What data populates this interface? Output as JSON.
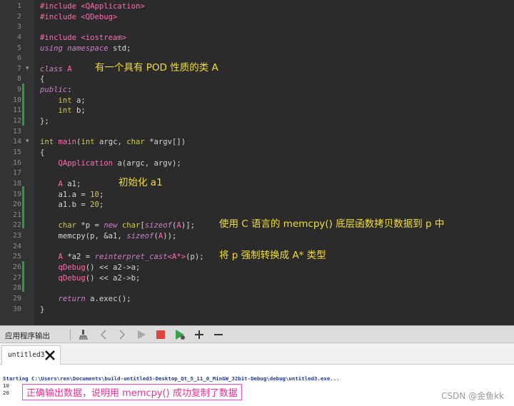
{
  "editor": {
    "lines": [
      {
        "n": "1",
        "tokens": [
          {
            "t": "#include ",
            "c": "pp"
          },
          {
            "t": "<QApplication>",
            "c": "pp"
          }
        ]
      },
      {
        "n": "2",
        "tokens": [
          {
            "t": "#include ",
            "c": "pp"
          },
          {
            "t": "<QDebug>",
            "c": "pp"
          }
        ]
      },
      {
        "n": "3",
        "tokens": []
      },
      {
        "n": "4",
        "tokens": [
          {
            "t": "#include ",
            "c": "pp"
          },
          {
            "t": "<iostream>",
            "c": "pp"
          }
        ]
      },
      {
        "n": "5",
        "tokens": [
          {
            "t": "using namespace",
            "c": "it"
          },
          {
            "t": " std;",
            "c": ""
          }
        ]
      },
      {
        "n": "6",
        "tokens": []
      },
      {
        "n": "7",
        "tokens": [
          {
            "t": "class",
            "c": "it"
          },
          {
            "t": " A",
            "c": "ty"
          }
        ]
      },
      {
        "n": "8",
        "tokens": [
          {
            "t": "{",
            "c": ""
          }
        ]
      },
      {
        "n": "9",
        "tokens": [
          {
            "t": "public",
            "c": "it"
          },
          {
            "t": ":",
            "c": ""
          }
        ]
      },
      {
        "n": "10",
        "tokens": [
          {
            "t": "    ",
            "c": ""
          },
          {
            "t": "int",
            "c": "kw"
          },
          {
            "t": " a;",
            "c": ""
          }
        ]
      },
      {
        "n": "11",
        "tokens": [
          {
            "t": "    ",
            "c": ""
          },
          {
            "t": "int",
            "c": "kw"
          },
          {
            "t": " b;",
            "c": ""
          }
        ]
      },
      {
        "n": "12",
        "tokens": [
          {
            "t": "};",
            "c": ""
          }
        ]
      },
      {
        "n": "13",
        "tokens": []
      },
      {
        "n": "14",
        "tokens": [
          {
            "t": "int",
            "c": "kw"
          },
          {
            "t": " ",
            "c": ""
          },
          {
            "t": "main",
            "c": "ty"
          },
          {
            "t": "(",
            "c": ""
          },
          {
            "t": "int",
            "c": "kw"
          },
          {
            "t": " argc, ",
            "c": ""
          },
          {
            "t": "char",
            "c": "kw"
          },
          {
            "t": " *argv[])",
            "c": ""
          }
        ]
      },
      {
        "n": "15",
        "tokens": [
          {
            "t": "{",
            "c": ""
          }
        ]
      },
      {
        "n": "16",
        "tokens": [
          {
            "t": "    ",
            "c": ""
          },
          {
            "t": "QApplication",
            "c": "ty"
          },
          {
            "t": " a(argc, argv);",
            "c": ""
          }
        ]
      },
      {
        "n": "17",
        "tokens": []
      },
      {
        "n": "18",
        "tokens": [
          {
            "t": "    ",
            "c": ""
          },
          {
            "t": "A",
            "c": "ty"
          },
          {
            "t": " a1;",
            "c": ""
          }
        ]
      },
      {
        "n": "19",
        "tokens": [
          {
            "t": "    a1.a = ",
            "c": ""
          },
          {
            "t": "10",
            "c": "kw"
          },
          {
            "t": ";",
            "c": ""
          }
        ]
      },
      {
        "n": "20",
        "tokens": [
          {
            "t": "    a1.b = ",
            "c": ""
          },
          {
            "t": "20",
            "c": "kw"
          },
          {
            "t": ";",
            "c": ""
          }
        ]
      },
      {
        "n": "21",
        "tokens": []
      },
      {
        "n": "22",
        "tokens": [
          {
            "t": "    ",
            "c": ""
          },
          {
            "t": "char",
            "c": "kw"
          },
          {
            "t": " *p = ",
            "c": ""
          },
          {
            "t": "new",
            "c": "it"
          },
          {
            "t": " ",
            "c": ""
          },
          {
            "t": "char",
            "c": "kw"
          },
          {
            "t": "[",
            "c": ""
          },
          {
            "t": "sizeof",
            "c": "it"
          },
          {
            "t": "(",
            "c": ""
          },
          {
            "t": "A",
            "c": "ty"
          },
          {
            "t": ")];",
            "c": ""
          }
        ]
      },
      {
        "n": "23",
        "tokens": [
          {
            "t": "    memcpy(p, &a1, ",
            "c": ""
          },
          {
            "t": "sizeof",
            "c": "it"
          },
          {
            "t": "(",
            "c": ""
          },
          {
            "t": "A",
            "c": "ty"
          },
          {
            "t": "));",
            "c": ""
          }
        ]
      },
      {
        "n": "24",
        "tokens": []
      },
      {
        "n": "25",
        "tokens": [
          {
            "t": "    ",
            "c": ""
          },
          {
            "t": "A",
            "c": "ty"
          },
          {
            "t": " *a2 = ",
            "c": ""
          },
          {
            "t": "reinterpret_cast",
            "c": "it"
          },
          {
            "t": "<A*>",
            "c": "ty"
          },
          {
            "t": "(p);",
            "c": ""
          }
        ]
      },
      {
        "n": "26",
        "tokens": [
          {
            "t": "    ",
            "c": ""
          },
          {
            "t": "qDebug",
            "c": "ty"
          },
          {
            "t": "() << a2->a;",
            "c": ""
          }
        ]
      },
      {
        "n": "27",
        "tokens": [
          {
            "t": "    ",
            "c": ""
          },
          {
            "t": "qDebug",
            "c": "ty"
          },
          {
            "t": "() << a2->b;",
            "c": ""
          }
        ]
      },
      {
        "n": "28",
        "tokens": []
      },
      {
        "n": "29",
        "tokens": [
          {
            "t": "    ",
            "c": ""
          },
          {
            "t": "return",
            "c": "it"
          },
          {
            "t": " a.exec();",
            "c": ""
          }
        ]
      },
      {
        "n": "30",
        "tokens": [
          {
            "t": "}",
            "c": ""
          }
        ]
      }
    ],
    "annotations": {
      "class_pod": "有一个具有 POD 性质的类 A",
      "init_a1": "初始化 a1",
      "memcpy": "使用 C 语言的 memcpy() 底层函数拷贝数据到 p 中",
      "cast": "将 p 强制转换成 A* 类型"
    }
  },
  "output_panel": {
    "title": "应用程序输出",
    "tab_label": "untitled3",
    "start_line": "Starting C:\\Users\\ren\\Documents\\build-untitled3-Desktop_Qt_5_11_0_MinGW_32bit-Debug\\debug\\untitled3.exe...",
    "values": [
      "10",
      "20"
    ],
    "note": "正确输出数据，说明用 memcpy() 成功复制了数据"
  },
  "watermark": "CSDN @金鱼kk",
  "colors": {
    "editor_bg": "#2b2b2b",
    "preprocessor": "#ff6aad",
    "keyword": "#d2cb46",
    "annotation": "#f2de3a",
    "run_green": "#3aa34a",
    "stop_red": "#e0453c",
    "note_pink": "#e63399"
  }
}
